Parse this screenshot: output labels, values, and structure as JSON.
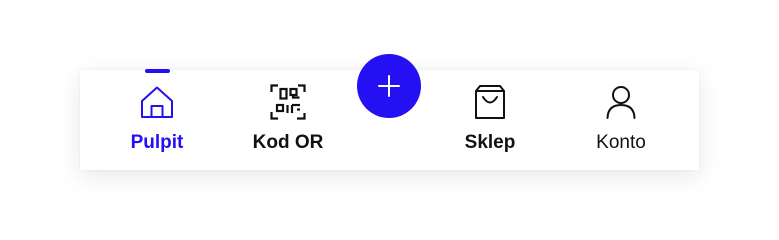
{
  "tabbar": {
    "items": [
      {
        "label": "Pulpit",
        "icon": "home-icon",
        "active": true
      },
      {
        "label": "Kod OR",
        "icon": "qr-code-icon",
        "active": false
      },
      {
        "label": "Sklep",
        "icon": "shopping-bag-icon",
        "active": false
      },
      {
        "label": "Konto",
        "icon": "user-icon",
        "active": false
      }
    ],
    "fab": {
      "icon": "plus-icon"
    }
  },
  "colors": {
    "accent": "#2410f2",
    "text": "#111111",
    "background": "#ffffff"
  }
}
